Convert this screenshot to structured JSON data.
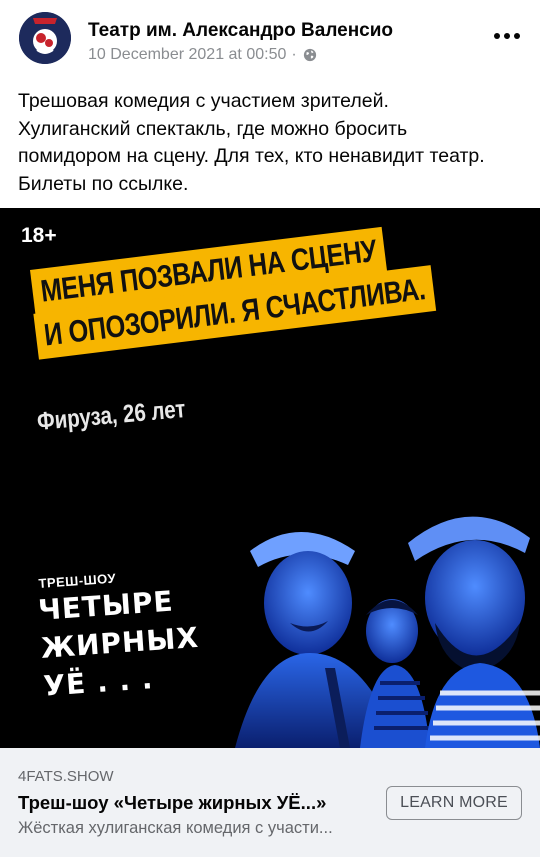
{
  "post": {
    "author": "Театр им. Александро Валенсио",
    "timestamp": "10 December 2021 at 00:50",
    "separator": "·",
    "privacy_icon": "globe-icon",
    "more_icon": "more-horizontal-icon",
    "text_lines": [
      "Трешовая комедия с участием зрителей.",
      "Хулиганский спектакль, где можно бросить",
      "помидором на сцену. Для тех, кто ненавидит театр.",
      "Билеты по ссылке."
    ]
  },
  "media": {
    "age_rating": "18+",
    "quote_line_1": "Меня позвали на сцену",
    "quote_line_2": "и опозорили. Я счастлива.",
    "attribution": "Фируза, 26 лет",
    "show_kicker": "ТРЕШ-ШОУ",
    "show_title_1": "ЧЕТЫРЕ",
    "show_title_2": "ЖИРНЫХ",
    "show_title_3": "УЁ . . ."
  },
  "link_preview": {
    "domain": "4FATS.SHOW",
    "title": "Треш-шоу «Четыре жирных УЁ...»",
    "description": "Жёсткая хулиганская комедия с участи...",
    "cta_label": "LEARN MORE"
  },
  "colors": {
    "highlight": "#f7b500",
    "photo_blue": "#1f5fe0",
    "card_bg": "#f0f2f5",
    "meta_text": "#8a8d91"
  }
}
